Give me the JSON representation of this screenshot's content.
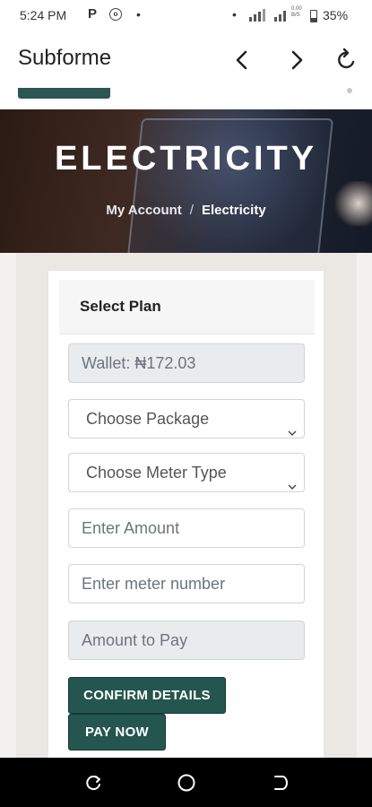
{
  "status_bar": {
    "time": "5:24 PM",
    "p_icon": "P",
    "network_label_top": "0.00",
    "network_label_bottom": "B/S",
    "battery_percent": "35%",
    "icons": [
      "parking-icon",
      "circle-notification-icon",
      "signal-icon",
      "battery-icon"
    ]
  },
  "browser": {
    "title": "Subforme",
    "icons": [
      "back-icon",
      "forward-icon",
      "reload-icon"
    ]
  },
  "hero": {
    "title": "ELECTRICITY",
    "breadcrumb_link": "My Account",
    "breadcrumb_separator": "/",
    "breadcrumb_current": "Electricity"
  },
  "form": {
    "header": "Select Plan",
    "wallet": "Wallet: ₦172.03",
    "package_select": "Choose Package",
    "meter_type_select": "Choose Meter Type",
    "amount_placeholder": "Enter Amount",
    "meter_number_placeholder": "Enter meter number",
    "amount_to_pay": "Amount to Pay",
    "confirm_button": "CONFIRM DETAILS",
    "pay_button": "PAY NOW"
  },
  "colors": {
    "accent": "#24554f",
    "readonly_bg": "#e9ecef",
    "page_bg": "#ebe8e4"
  },
  "android_nav": {
    "icons": [
      "recents-icon",
      "home-icon",
      "back-nav-icon"
    ]
  }
}
